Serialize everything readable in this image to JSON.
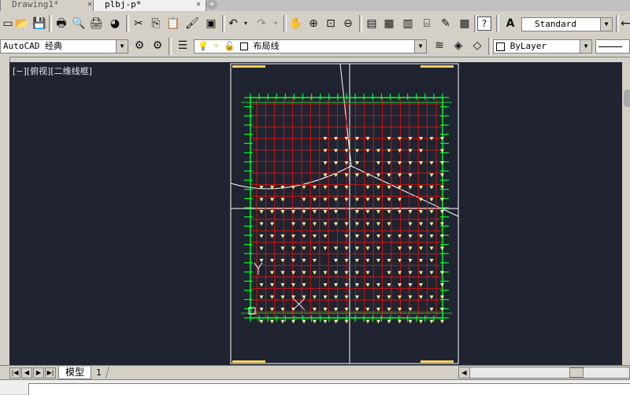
{
  "doc_tabs": [
    {
      "label": "Drawing1*"
    },
    {
      "label": "plbj-p*"
    }
  ],
  "toolbar": {
    "text_style": "Standard",
    "workspace": "AutoCAD 经典",
    "layer": "布局线",
    "color": "ByLayer"
  },
  "viewport": {
    "label": "[−][俯视][二维线框]"
  },
  "layout_tabs": {
    "model": "模型",
    "layout1": "1"
  },
  "colors": {
    "canvas_bg": "#1f2430",
    "axis": "#00ff33",
    "beam": "#e01010",
    "column": "#fff2a0",
    "sheet": "#ffffff"
  }
}
